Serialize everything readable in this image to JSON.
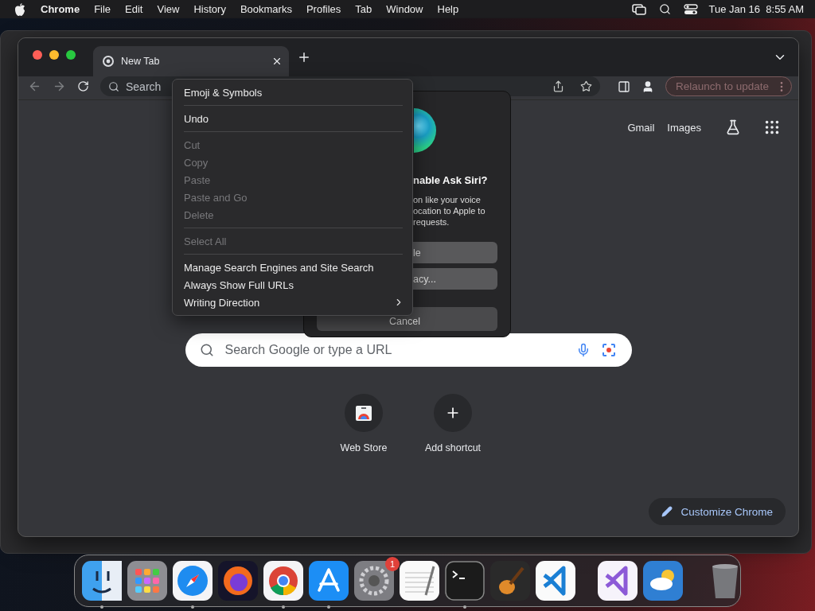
{
  "menu_bar": {
    "app": "Chrome",
    "items": [
      "File",
      "Edit",
      "View",
      "History",
      "Bookmarks",
      "Profiles",
      "Tab",
      "Window",
      "Help"
    ],
    "datetime": "Tue Jan 16  8:55 AM"
  },
  "browser": {
    "tab": {
      "title": "New Tab"
    },
    "address": {
      "placeholder": "Search"
    },
    "relaunch_button": "Relaunch to update",
    "links": [
      "Gmail",
      "Images"
    ],
    "search": {
      "placeholder": "Search Google or type a URL"
    },
    "shortcuts": [
      {
        "label": "Web Store",
        "kind": "store"
      },
      {
        "label": "Add shortcut",
        "kind": "add"
      }
    ],
    "customize_button": "Customize Chrome"
  },
  "siri_dialog": {
    "title": "nable Ask Siri?",
    "body": [
      "on like your voice",
      "ocation to Apple to",
      "requests."
    ],
    "buttons": [
      "le",
      "acy...",
      "Cancel"
    ]
  },
  "context_menu": {
    "sections": [
      [
        {
          "label": "Emoji & Symbols",
          "disabled": false,
          "submenu": false
        }
      ],
      [
        {
          "label": "Undo",
          "disabled": false,
          "submenu": false
        }
      ],
      [
        {
          "label": "Cut",
          "disabled": true,
          "submenu": false
        },
        {
          "label": "Copy",
          "disabled": true,
          "submenu": false
        },
        {
          "label": "Paste",
          "disabled": true,
          "submenu": false
        },
        {
          "label": "Paste and Go",
          "disabled": true,
          "submenu": false
        },
        {
          "label": "Delete",
          "disabled": true,
          "submenu": false
        }
      ],
      [
        {
          "label": "Select All",
          "disabled": true,
          "submenu": false
        }
      ],
      [
        {
          "label": "Manage Search Engines and Site Search",
          "disabled": false,
          "submenu": false
        },
        {
          "label": "Always Show Full URLs",
          "disabled": false,
          "submenu": false
        },
        {
          "label": "Writing Direction",
          "disabled": false,
          "submenu": true
        }
      ]
    ]
  },
  "dock": {
    "apps": [
      {
        "kind": "finder",
        "running": true
      },
      {
        "kind": "launchpad",
        "running": false
      },
      {
        "kind": "safari",
        "running": true
      },
      {
        "kind": "firefox",
        "running": false
      },
      {
        "kind": "chrome",
        "running": true
      },
      {
        "kind": "appstore",
        "running": true
      },
      {
        "kind": "settings",
        "running": false,
        "badge": "1"
      },
      {
        "kind": "textedit",
        "running": false
      },
      {
        "kind": "terminal",
        "running": true
      },
      {
        "kind": "garageband",
        "running": false
      },
      {
        "kind": "vscode",
        "running": false
      },
      {
        "kind": "divider"
      },
      {
        "kind": "vs",
        "running": false
      },
      {
        "kind": "weather",
        "running": false
      },
      {
        "kind": "divider"
      },
      {
        "kind": "trash",
        "running": false
      }
    ]
  }
}
